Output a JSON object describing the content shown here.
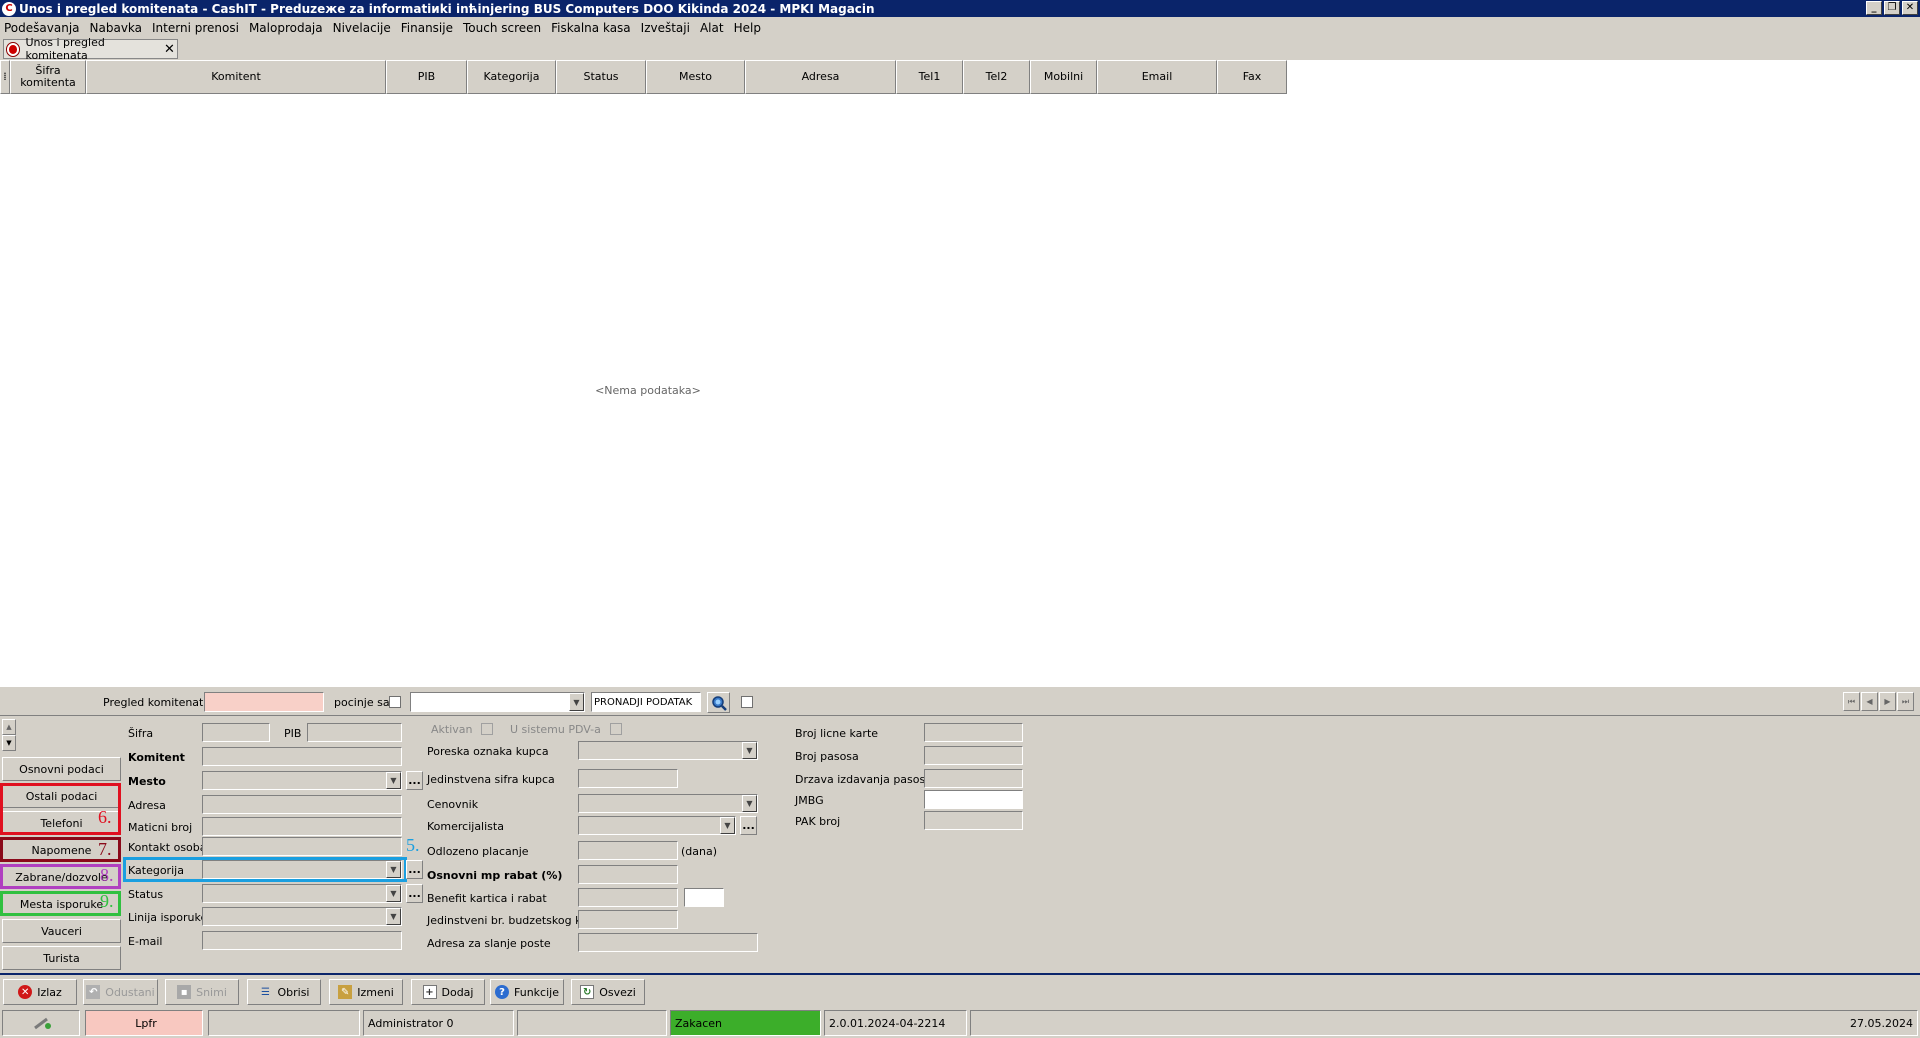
{
  "window": {
    "title": "Unos i pregled komitenata - CashIT - Preduzeжe za informatiиki inћinjering BUS Computers DOO Kikinda 2024 - MPKI Magacin",
    "app_icon_letter": "C"
  },
  "menu": [
    "Podešavanja",
    "Nabavka",
    "Interni prenosi",
    "Maloprodaja",
    "Nivelacije",
    "Finansije",
    "Touch screen",
    "Fiskalna kasa",
    "Izveštaji",
    "Alat",
    "Help"
  ],
  "tab": {
    "label": "Unos i pregled komitenata"
  },
  "grid": {
    "columns": [
      "Šifra komitenta",
      "Komitent",
      "PIB",
      "Kategorija",
      "Status",
      "Mesto",
      "Adresa",
      "Tel1",
      "Tel2",
      "Mobilni",
      "Email",
      "Fax"
    ],
    "empty_text": "<Nema podataka>"
  },
  "search": {
    "label": "Pregled komitenata",
    "starts_with_label": "pocinje sa",
    "find_button": "PRONADJI PODATAK"
  },
  "side_tabs": [
    "Osnovni podaci",
    "Ostali podaci",
    "Telefoni",
    "Napomene",
    "Zabrane/dozvole",
    "Mesta isporuke",
    "Vauceri",
    "Turista"
  ],
  "form": {
    "col1": {
      "sifra": "Šifra",
      "pib": "PIB",
      "komitent": "Komitent",
      "mesto": "Mesto",
      "adresa": "Adresa",
      "maticni_broj": "Maticni broj",
      "kontakt_osoba": "Kontakt osoba",
      "kategorija": "Kategorija",
      "status": "Status",
      "linija_isporuke": "Linija isporuke",
      "email": "E-mail"
    },
    "col2": {
      "aktivan": "Aktivan",
      "u_sistemu_pdv": "U sistemu PDV-a",
      "poreska_oznaka": "Poreska oznaka kupca",
      "jedinstvena_sifra": "Jedinstvena sifra kupca",
      "cenovnik": "Cenovnik",
      "komercijalista": "Komercijalista",
      "odlozeno_placanje": "Odlozeno placanje",
      "dana": "(dana)",
      "osnovni_rabat": "Osnovni mp rabat (%)",
      "benefit": "Benefit kartica i rabat",
      "jbkjs": "Jedinstveni br. budzetskog kor.",
      "adresa_poste": "Adresa za slanje poste"
    },
    "col3": {
      "broj_licne": "Broj licne karte",
      "broj_pasosa": "Broj pasosa",
      "drzava_pasosa": "Drzava izdavanja pasosa",
      "jmbg": "JMBG",
      "pak_broj": "PAK broj"
    }
  },
  "annotations": [
    {
      "number": "5.",
      "color": "#1a9fe0"
    },
    {
      "number": "6.",
      "color": "#e01020"
    },
    {
      "number": "7.",
      "color": "#8a0a1a"
    },
    {
      "number": "8.",
      "color": "#b040c0"
    },
    {
      "number": "9.",
      "color": "#30c040"
    }
  ],
  "toolbar": {
    "izlaz": "Izlaz",
    "odustani": "Odustani",
    "snimi": "Snimi",
    "obrisi": "Obrisi",
    "izmeni": "Izmeni",
    "dodaj": "Dodaj",
    "funkcije": "Funkcije",
    "osvezi": "Osvezi"
  },
  "status": {
    "lpfr": "Lpfr",
    "user": "Administrator 0",
    "connection": "Zakacen",
    "version": "2.0.01.2024-04-2214",
    "date": "27.05.2024",
    "lpfr_color": "#f8c8c0",
    "connection_color": "#3cae2a"
  }
}
